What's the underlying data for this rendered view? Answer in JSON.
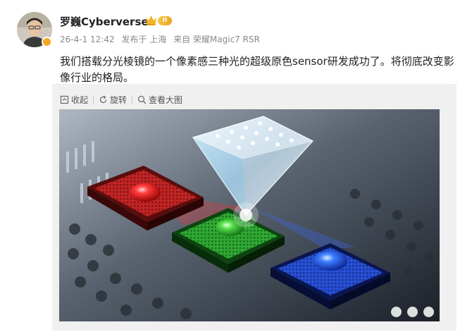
{
  "user": {
    "name": "罗巍Cyberverse",
    "level": "II",
    "avatar_icon": "user-avatar"
  },
  "meta": {
    "time": "26-4-1 12:42",
    "posted_from": "发布于 上海",
    "device": "来自 荣耀Magic7 RSR"
  },
  "post": {
    "text": "我们搭载分光棱镜的一个像素感三种光的超级原色sensor研发成功了。将彻底改变影像行业的格局。"
  },
  "toolbar": {
    "collapse_label": "收起",
    "rotate_label": "旋转",
    "view_large_label": "查看大图"
  },
  "colors": {
    "accent_orange": "#f5a623",
    "meta_gray": "#8a8a8a",
    "panel_gray": "#f0f0f0"
  }
}
